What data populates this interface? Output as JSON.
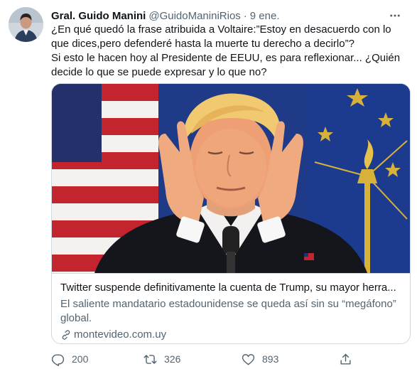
{
  "tweet": {
    "display_name": "Gral. Guido Manini",
    "handle": "@GuidoManiniRios",
    "separator": "·",
    "date": "9 ene.",
    "text_lines": [
      "¿En qué quedó la frase atribuida a Voltaire:”Estoy en desacuerdo con lo",
      "que dices,pero defenderé hasta la muerte tu derecho a decirlo”?",
      "Si esto le hacen hoy al Presidente de EEUU, es para reflexionar... ¿Quién",
      "decide lo que se puede expresar y lo que no?"
    ]
  },
  "card": {
    "title": "Twitter suspende definitivamente la cuenta de Trump, su mayor herra...",
    "description": "El saliente mandatario estadounidense se queda así sin su “megáfono” global.",
    "domain": "montevideo.com.uy"
  },
  "actions": {
    "reply_count": "200",
    "retweet_count": "326",
    "like_count": "893"
  },
  "icons": {
    "more": "more-icon",
    "link": "link-icon",
    "reply": "reply-icon",
    "retweet": "retweet-icon",
    "like": "like-icon",
    "share": "share-icon"
  },
  "colors": {
    "text_primary": "#0f1419",
    "text_secondary": "#536471",
    "border": "#cfd9de"
  }
}
